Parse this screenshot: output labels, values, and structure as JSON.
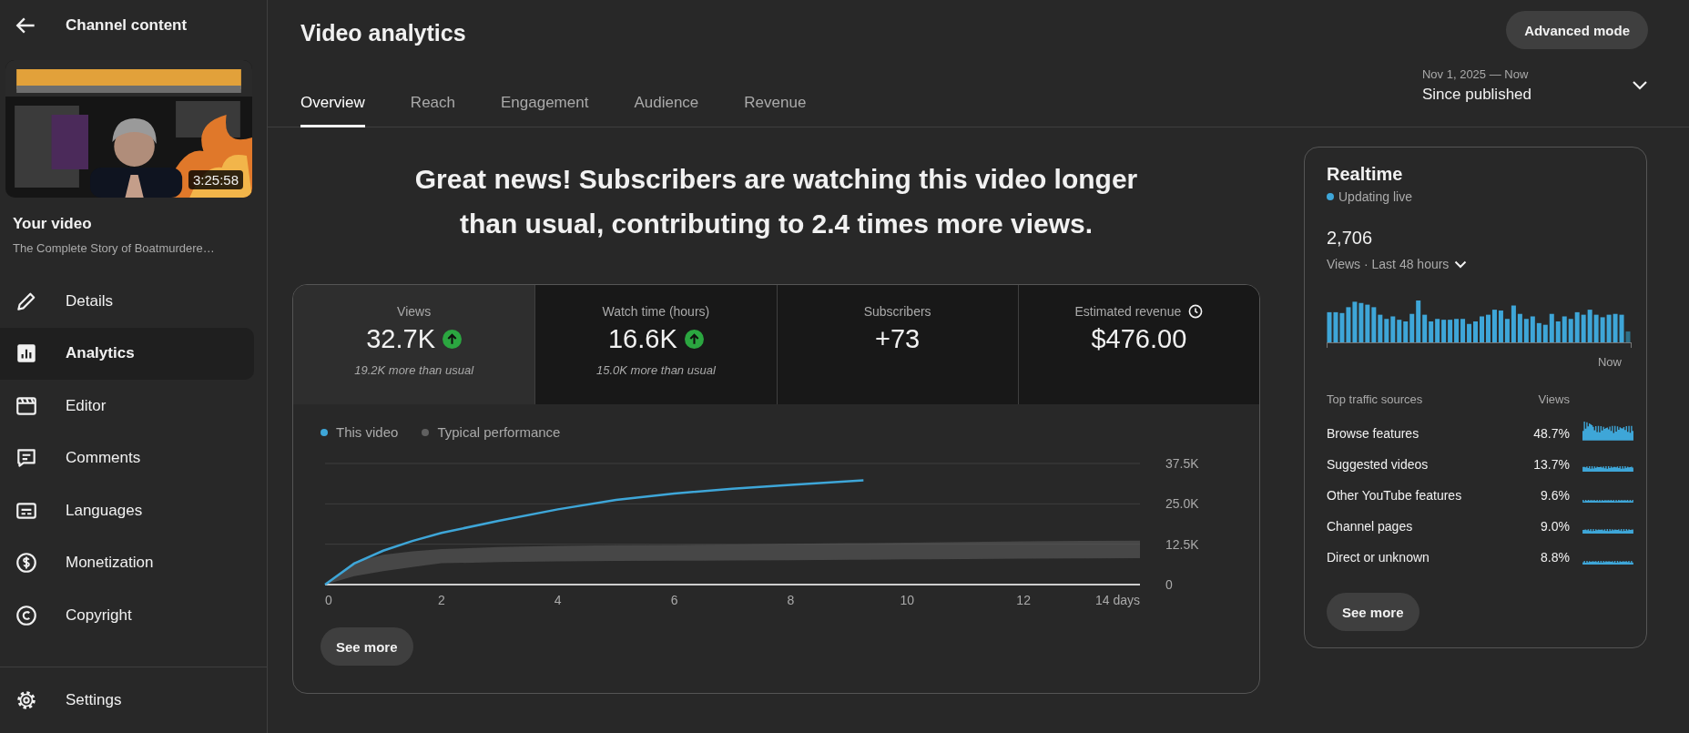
{
  "sidebar": {
    "back_label": "Channel content",
    "thumbnail": {
      "kind": "picture",
      "duration": "3:25:58"
    },
    "video_heading": "Your video",
    "video_title": "The Complete Story of Boatmurdere…",
    "items": [
      {
        "label": "Details",
        "selected": false
      },
      {
        "label": "Analytics",
        "selected": true
      },
      {
        "label": "Editor",
        "selected": false
      },
      {
        "label": "Comments",
        "selected": false
      },
      {
        "label": "Languages",
        "selected": false
      },
      {
        "label": "Monetization",
        "selected": false
      },
      {
        "label": "Copyright",
        "selected": false
      }
    ],
    "settings": {
      "label": "Settings"
    }
  },
  "header": {
    "title": "Video analytics",
    "advanced_button": "Advanced mode",
    "tabs": [
      {
        "label": "Overview",
        "selected": true
      },
      {
        "label": "Reach",
        "selected": false
      },
      {
        "label": "Engagement",
        "selected": false
      },
      {
        "label": "Audience",
        "selected": false
      },
      {
        "label": "Revenue",
        "selected": false
      }
    ],
    "date_range": {
      "range": "Nov 1, 2025 — Now",
      "label": "Since published"
    }
  },
  "headline": "Great news! Subscribers are watching this video longer than usual, contributing to 2.4 times more views.",
  "metrics": [
    {
      "kind": "rising",
      "label": "Views",
      "value": "32.7K",
      "note": "19.2K more than usual",
      "selected": true
    },
    {
      "kind": "rising",
      "label": "Watch time (hours)",
      "value": "16.6K",
      "note": "15.0K more than usual",
      "selected": false
    },
    {
      "kind": "plain",
      "label": "Subscribers",
      "value": "+73",
      "selected": false
    },
    {
      "kind": "pending",
      "label": "Estimated revenue",
      "value": "$476.00",
      "selected": false
    }
  ],
  "chart": {
    "see_more": "See more",
    "chart_data": {
      "type": "line",
      "x": [
        0,
        0.5,
        1,
        1.5,
        2,
        3,
        4,
        5,
        6,
        7,
        8,
        9,
        9.25,
        10,
        11,
        12,
        13,
        14
      ],
      "xticks": [
        0,
        2,
        4,
        6,
        8,
        10,
        12,
        {
          "value": 14,
          "label": "14 days"
        }
      ],
      "yticks": [
        0,
        {
          "value": 12500,
          "label": "12.5K"
        },
        {
          "value": 25000,
          "label": "25.0K"
        },
        {
          "value": 37500,
          "label": "37.5K"
        }
      ],
      "xlim": [
        0,
        14
      ],
      "ylim": [
        0,
        37500
      ],
      "series": [
        {
          "name": "This video",
          "color": "#3ea6d8",
          "values": [
            0,
            6500,
            10500,
            13500,
            16000,
            19800,
            23300,
            26200,
            28200,
            29700,
            30900,
            32000,
            32300,
            null,
            null,
            null,
            null,
            null
          ]
        },
        {
          "name": "Typical performance",
          "type": "area",
          "color": "#606060",
          "values": [
            0,
            7000,
            9200,
            10300,
            11000,
            11600,
            12000,
            12200,
            12300,
            12400,
            12600,
            12800,
            12800,
            13000,
            13200,
            13400,
            13500,
            13600
          ]
        }
      ]
    }
  },
  "realtime": {
    "title": "Realtime",
    "status": "Updating live",
    "count": "2,706",
    "period": "Views · Last 48 hours",
    "now_label": "Now",
    "sources_header": "Top traffic sources",
    "views_header": "Views",
    "sources": [
      {
        "name": "Browse features",
        "share": "48.7%"
      },
      {
        "name": "Suggested videos",
        "share": "13.7%"
      },
      {
        "name": "Other YouTube features",
        "share": "9.6%"
      },
      {
        "name": "Channel pages",
        "share": "9.0%"
      },
      {
        "name": "Direct or unknown",
        "share": "8.8%"
      }
    ],
    "see_more": "See more"
  }
}
